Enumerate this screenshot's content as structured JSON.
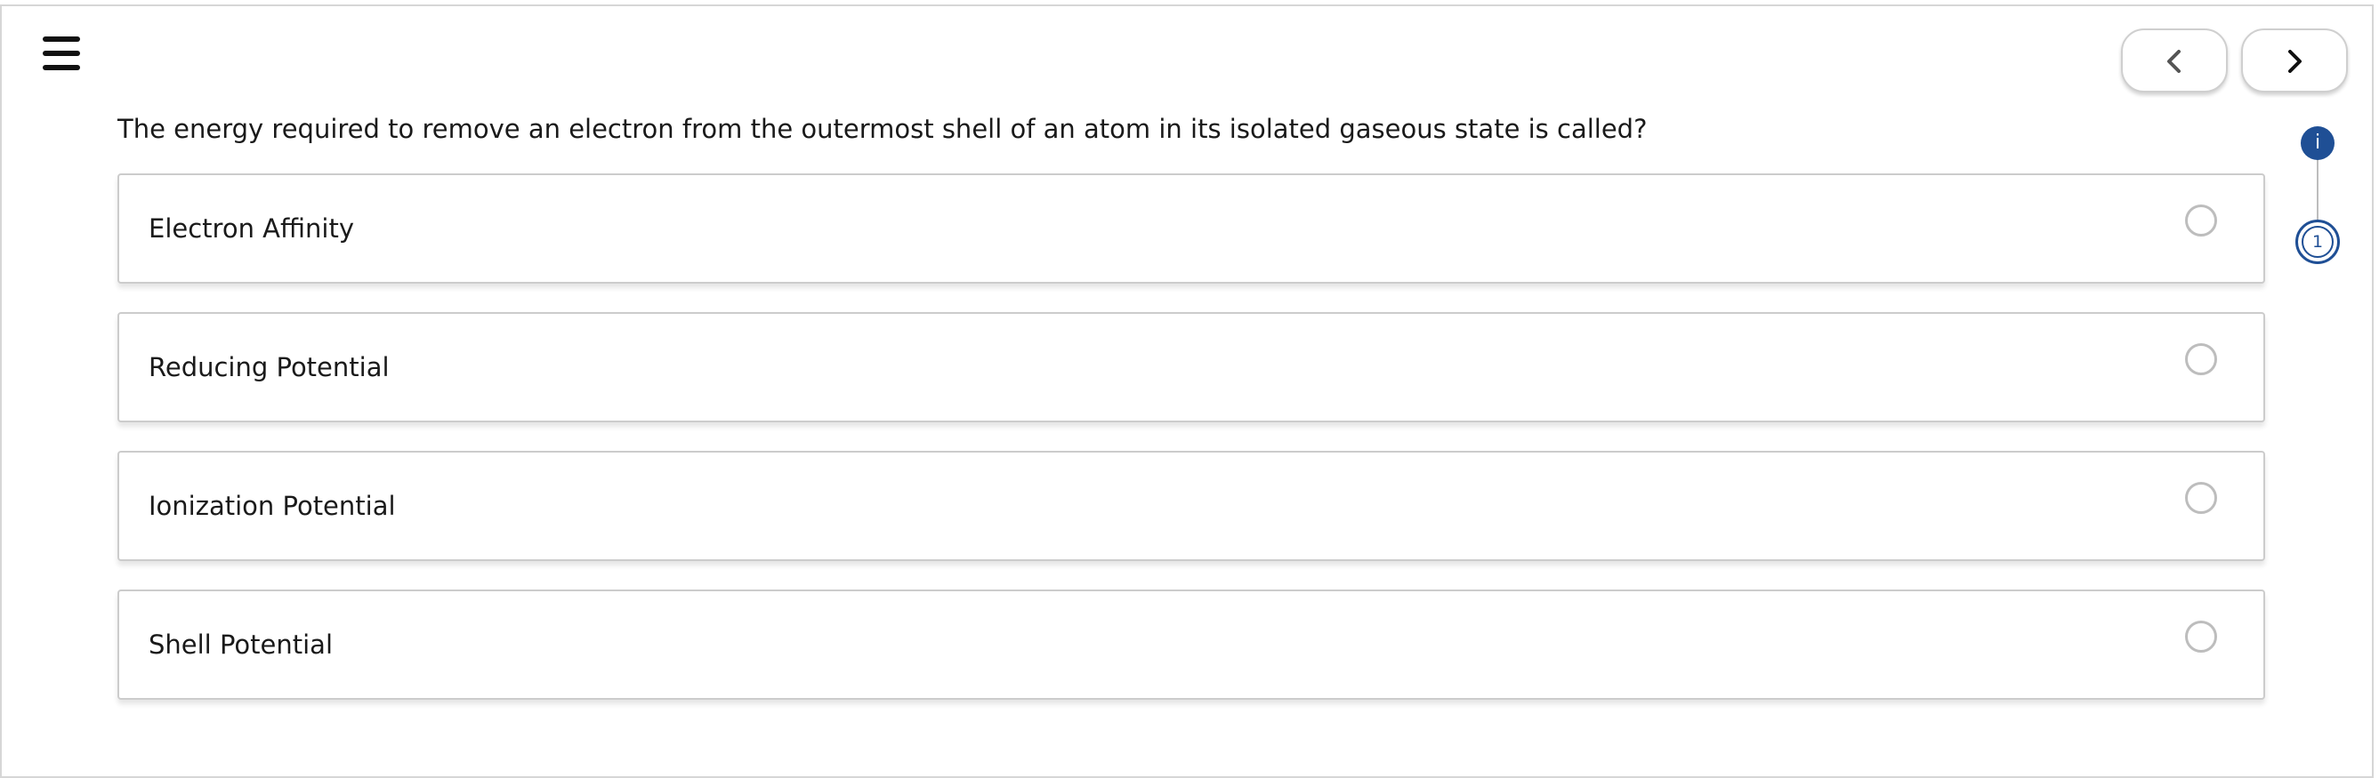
{
  "question": {
    "text": "The energy required to remove an electron from the outermost shell of an atom in its isolated gaseous state is called?"
  },
  "options": [
    {
      "label": "Electron Affinity",
      "selected": false
    },
    {
      "label": "Reducing Potential",
      "selected": false
    },
    {
      "label": "Ionization Potential",
      "selected": false
    },
    {
      "label": "Shell Potential",
      "selected": false
    }
  ],
  "stepper": {
    "info_label": "i",
    "current_step": "1"
  },
  "icons": {
    "menu": "hamburger-menu-icon",
    "prev": "chevron-left-icon",
    "next": "chevron-right-icon"
  },
  "colors": {
    "accent": "#1f4f95",
    "border": "#cccccc",
    "text": "#1a1a1a"
  }
}
